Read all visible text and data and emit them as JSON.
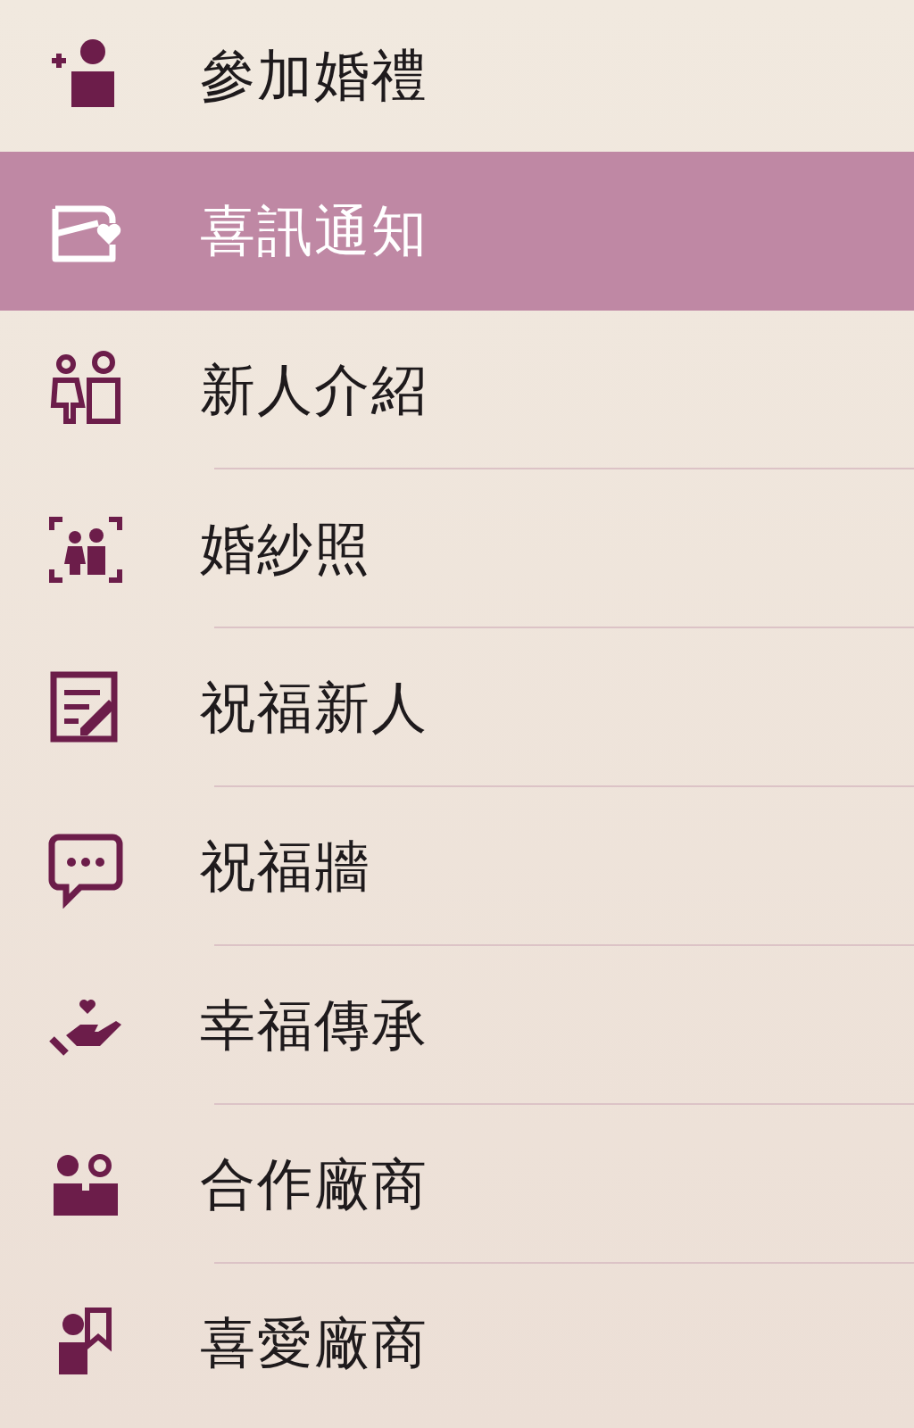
{
  "menu": {
    "items": [
      {
        "label": "參加婚禮",
        "selected": false
      },
      {
        "label": "喜訊通知",
        "selected": true
      },
      {
        "label": "新人介紹",
        "selected": false
      },
      {
        "label": "婚紗照",
        "selected": false
      },
      {
        "label": "祝福新人",
        "selected": false
      },
      {
        "label": "祝福牆",
        "selected": false
      },
      {
        "label": "幸福傳承",
        "selected": false
      },
      {
        "label": "合作廠商",
        "selected": false
      },
      {
        "label": "喜愛廠商",
        "selected": false
      }
    ]
  }
}
